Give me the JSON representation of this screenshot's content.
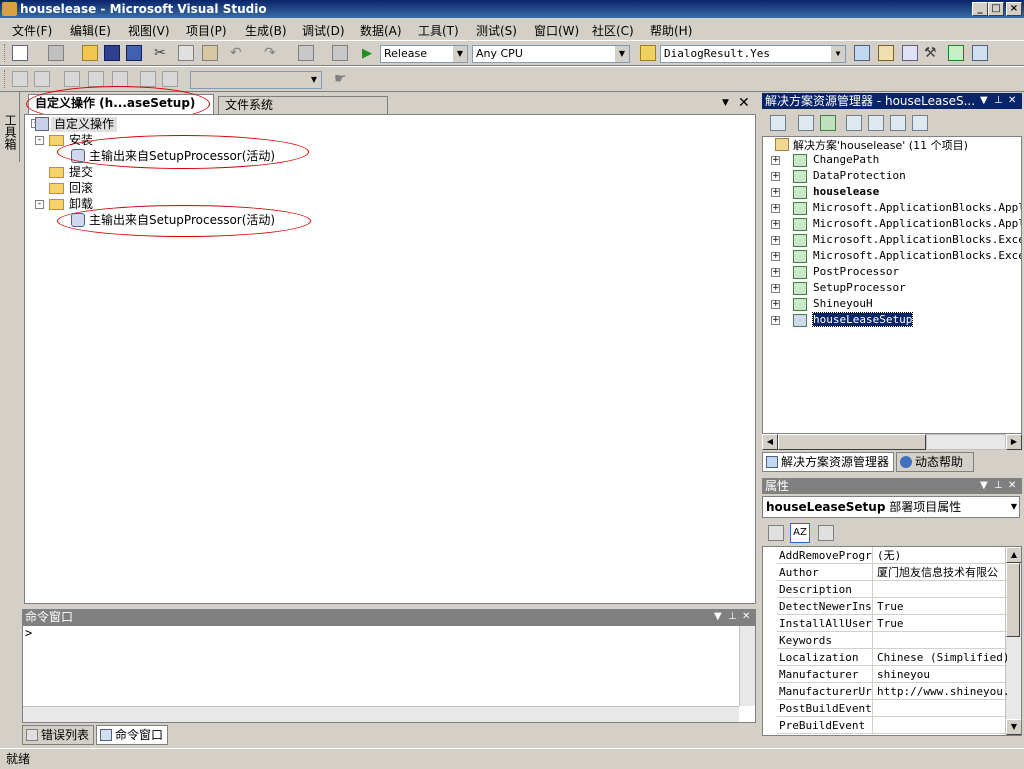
{
  "window": {
    "title": "houselease - Microsoft Visual Studio"
  },
  "menu": [
    "文件(F)",
    "编辑(E)",
    "视图(V)",
    "项目(P)",
    "生成(B)",
    "调试(D)",
    "数据(A)",
    "工具(T)",
    "测试(S)",
    "窗口(W)",
    "社区(C)",
    "帮助(H)"
  ],
  "toolbar": {
    "config": "Release",
    "platform": "Any CPU",
    "find": "DialogResult.Yes"
  },
  "left_toolbox": "工具箱",
  "doc_tabs": [
    "自定义操作 (h...aseSetup)",
    "文件系统 (houseLeaseSetup)"
  ],
  "tree": {
    "root": "自定义操作",
    "install": "安装",
    "commit": "提交",
    "rollback": "回滚",
    "uninstall": "卸载",
    "install_child": "主输出来自SetupProcessor(活动)",
    "uninstall_child": "主输出来自SetupProcessor(活动)"
  },
  "command_window": {
    "title": "命令窗口",
    "prompt": ">"
  },
  "bottom_tabs": [
    "错误列表",
    "命令窗口"
  ],
  "status": "就绪",
  "solution_explorer": {
    "title": "解决方案资源管理器 - houseLeaseS...",
    "root": "解决方案'houselease' (11 个项目)",
    "items": [
      "ChangePath",
      "DataProtection",
      "houselease",
      "Microsoft.ApplicationBlocks.Applica",
      "Microsoft.ApplicationBlocks.Applica",
      "Microsoft.ApplicationBlocks.Excepti",
      "Microsoft.ApplicationBlocks.Excepti",
      "PostProcessor",
      "SetupProcessor",
      "ShineyouH",
      "houseLeaseSetup"
    ]
  },
  "pane_tabs": [
    "解决方案资源管理器",
    "动态帮助"
  ],
  "properties": {
    "title": "属性",
    "selected_object": "houseLeaseSetup",
    "selected_type": "部署项目属性",
    "rows": [
      {
        "name": "AddRemoveProgran",
        "value": "(无)"
      },
      {
        "name": "Author",
        "value": "厦门旭友信息技术有限公"
      },
      {
        "name": "Description",
        "value": ""
      },
      {
        "name": "DetectNewerInst:",
        "value": "True"
      },
      {
        "name": "InstallAllUsers",
        "value": "True"
      },
      {
        "name": "Keywords",
        "value": ""
      },
      {
        "name": "Localization",
        "value": "Chinese (Simplified)"
      },
      {
        "name": "Manufacturer",
        "value": "shineyou"
      },
      {
        "name": "ManufacturerUrl",
        "value": "http://www.shineyou.cr"
      },
      {
        "name": "PostBuildEvent",
        "value": ""
      },
      {
        "name": "PreBuildEvent",
        "value": ""
      }
    ]
  }
}
